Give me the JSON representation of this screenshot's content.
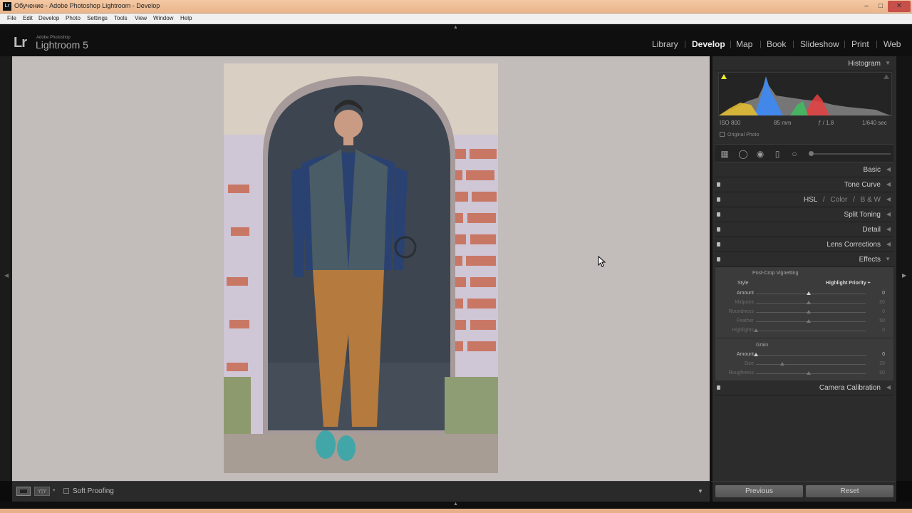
{
  "window": {
    "title": "Обучение - Adobe Photoshop Lightroom - Develop",
    "app_icon": "Lr",
    "controls": {
      "minimize": "–",
      "maximize": "□",
      "close": "✕"
    }
  },
  "menu": [
    "File",
    "Edit",
    "Develop",
    "Photo",
    "Settings",
    "Tools",
    "View",
    "Window",
    "Help"
  ],
  "identity": {
    "logo": "Lr",
    "sub": "Adobe Photoshop",
    "name": "Lightroom 5"
  },
  "modules": {
    "items": [
      "Library",
      "Develop",
      "Map",
      "Book",
      "Slideshow",
      "Print",
      "Web"
    ],
    "active": "Develop"
  },
  "histogram": {
    "title": "Histogram",
    "iso": "ISO 800",
    "focal": "85 mm",
    "aperture": "ƒ / 1.8",
    "shutter": "1/640 sec",
    "original_photo": "Original Photo"
  },
  "panels": {
    "basic": "Basic",
    "tone_curve": "Tone Curve",
    "hsl": {
      "hsl": "HSL",
      "sep": "/",
      "color": "Color",
      "bw": "B & W"
    },
    "split_toning": "Split Toning",
    "detail": "Detail",
    "lens_corrections": "Lens Corrections",
    "effects": "Effects",
    "camera_calibration": "Camera Calibration"
  },
  "effects": {
    "vignette_title": "Post-Crop Vignetting",
    "style_label": "Style",
    "style_value": "Highlight Priority ÷",
    "vignette": [
      {
        "label": "Amount",
        "value": "0",
        "level": 0.5,
        "dim": false
      },
      {
        "label": "Midpoint",
        "value": "50",
        "level": 0.5,
        "dim": true
      },
      {
        "label": "Roundness",
        "value": "0",
        "level": 0.5,
        "dim": true
      },
      {
        "label": "Feather",
        "value": "50",
        "level": 0.5,
        "dim": true
      },
      {
        "label": "Highlights",
        "value": "0",
        "level": 0.0,
        "dim": true
      }
    ],
    "grain_title": "Grain",
    "grain": [
      {
        "label": "Amount",
        "value": "0",
        "level": 0.0,
        "dim": false
      },
      {
        "label": "Size",
        "value": "25",
        "level": 0.25,
        "dim": true
      },
      {
        "label": "Roughness",
        "value": "50",
        "level": 0.5,
        "dim": true
      }
    ]
  },
  "toolbar": {
    "soft_proofing": "Soft Proofing",
    "yy": "Y|Y",
    "more": "▼"
  },
  "buttons": {
    "previous": "Previous",
    "reset": "Reset"
  },
  "colors": {
    "accent_window": "#e9b58c",
    "panel_bg": "#2c2c2c",
    "view_bg": "#c2bcbb"
  }
}
